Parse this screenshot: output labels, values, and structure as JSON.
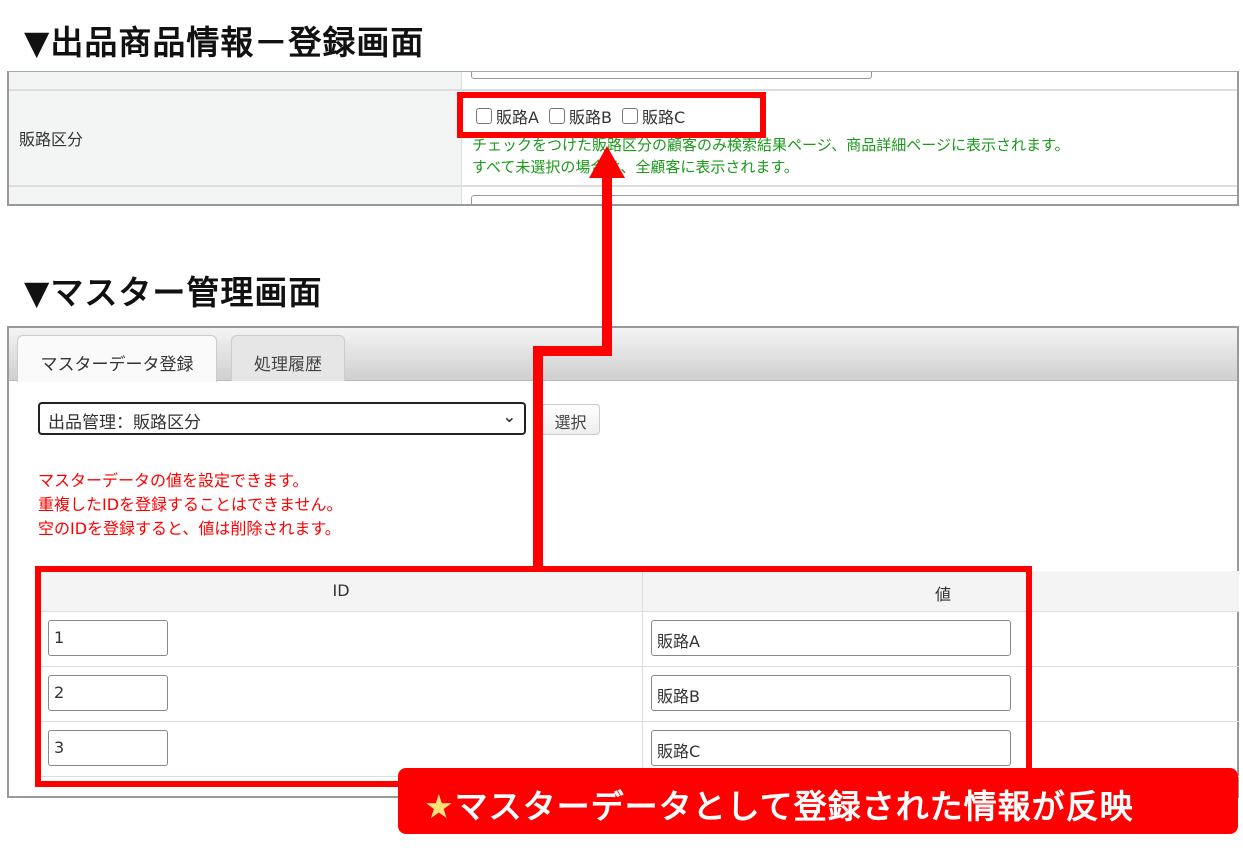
{
  "headings": {
    "product_screen": "▼出品商品情報－登録画面",
    "master_screen": "▼マスター管理画面"
  },
  "product_form": {
    "field_label": "販路区分",
    "checkboxes": [
      {
        "label": "販路A",
        "checked": false
      },
      {
        "label": "販路B",
        "checked": false
      },
      {
        "label": "販路C",
        "checked": false
      }
    ],
    "help_lines": [
      "チェックをつけた販路区分の顧客のみ検索結果ページ、商品詳細ページに表示されます。",
      "すべて未選択の場合は、全顧客に表示されます。"
    ]
  },
  "master": {
    "tabs": [
      {
        "label": "マスターデータ登録",
        "active": true
      },
      {
        "label": "処理履歴",
        "active": false
      }
    ],
    "select_value": "出品管理：販路区分",
    "select_button": "選択",
    "notes": [
      "マスターデータの値を設定できます。",
      "重複したIDを登録することはできません。",
      "空のIDを登録すると、値は削除されます。"
    ],
    "table": {
      "headers": [
        "ID",
        "値"
      ],
      "rows": [
        {
          "id": "1",
          "value": "販路A"
        },
        {
          "id": "2",
          "value": "販路B"
        },
        {
          "id": "3",
          "value": "販路C"
        }
      ]
    }
  },
  "callout": {
    "star": "★",
    "text": "マスターデータとして登録された情報が反映"
  },
  "colors": {
    "accent_red": "#ff0000",
    "help_green": "#1a9a1a"
  }
}
